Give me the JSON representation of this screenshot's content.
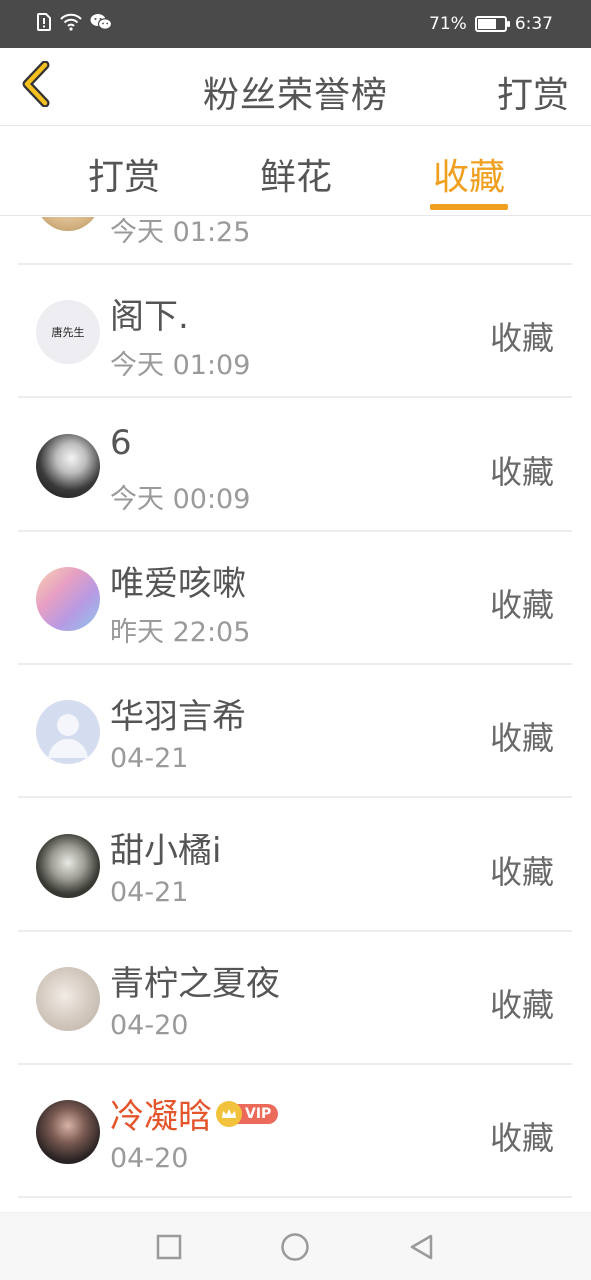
{
  "status_bar": {
    "battery_text": "71%",
    "battery_level": 0.71,
    "time": "6:37",
    "icons": [
      "alert-sim-icon",
      "wifi-icon",
      "wechat-icon",
      "battery-icon"
    ]
  },
  "header": {
    "title": "粉丝荣誉榜",
    "action_label": "打赏",
    "back_icon": "chevron-left-icon"
  },
  "colors": {
    "accent": "#f0a020",
    "vip_name": "#e5552c",
    "status_bar_bg": "#4a4a4a"
  },
  "tabs": [
    {
      "label": "打赏",
      "active": false
    },
    {
      "label": "鲜花",
      "active": false
    },
    {
      "label": "收藏",
      "active": true
    }
  ],
  "list": {
    "partial_top": {
      "time": "今天 01:25"
    },
    "items": [
      {
        "name": "阁下.",
        "time": "今天 01:09",
        "action": "收藏",
        "avatar_text": "唐先生"
      },
      {
        "name": "6",
        "time": "今天 00:09",
        "action": "收藏"
      },
      {
        "name": "唯爱咳嗽",
        "time": "昨天 22:05",
        "action": "收藏"
      },
      {
        "name": "华羽言希",
        "time": "04-21",
        "action": "收藏"
      },
      {
        "name": "甜小橘i",
        "time": "04-21",
        "action": "收藏"
      },
      {
        "name": "青柠之夏夜",
        "time": "04-20",
        "action": "收藏"
      },
      {
        "name": "冷凝晗",
        "time": "04-20",
        "action": "收藏",
        "vip": true,
        "vip_label": "VIP"
      }
    ]
  },
  "nav_bar": {
    "icons": [
      "recents-square-icon",
      "home-circle-icon",
      "back-triangle-icon"
    ]
  }
}
